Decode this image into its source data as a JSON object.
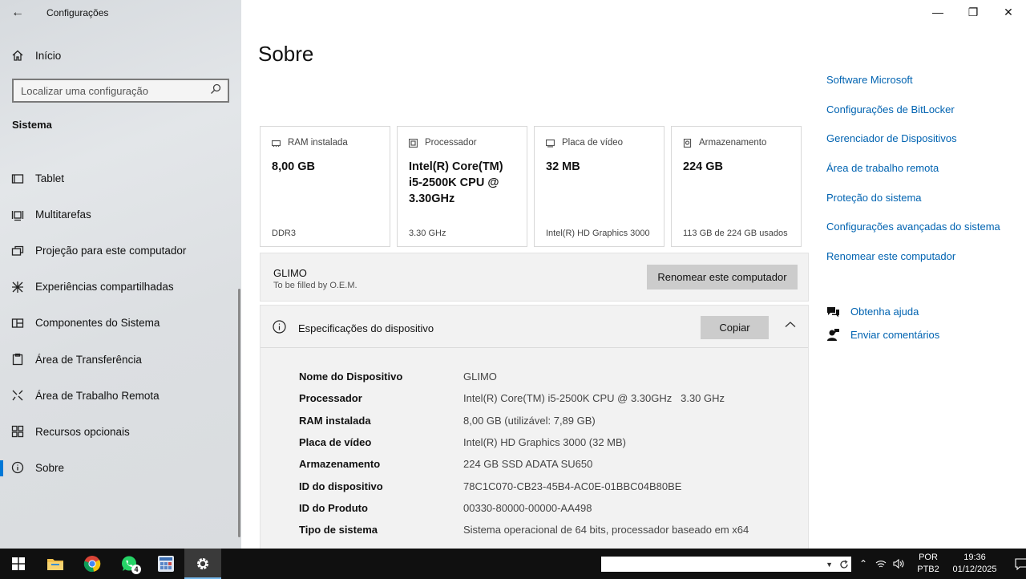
{
  "window": {
    "title": "Configurações"
  },
  "sidebar": {
    "home_label": "Início",
    "search_placeholder": "Localizar uma configuração",
    "section": "Sistema",
    "items": [
      {
        "label": "Tablet",
        "icon": "tablet-icon"
      },
      {
        "label": "Multitarefas",
        "icon": "multitasking-icon"
      },
      {
        "label": "Projeção para este computador",
        "icon": "projection-icon"
      },
      {
        "label": "Experiências compartilhadas",
        "icon": "shared-experiences-icon"
      },
      {
        "label": "Componentes do Sistema",
        "icon": "system-components-icon"
      },
      {
        "label": "Área de Transferência",
        "icon": "clipboard-icon"
      },
      {
        "label": "Área de Trabalho Remota",
        "icon": "remote-desktop-icon"
      },
      {
        "label": "Recursos opcionais",
        "icon": "optional-features-icon"
      },
      {
        "label": "Sobre",
        "icon": "info-icon",
        "active": true
      }
    ]
  },
  "main": {
    "title": "Sobre",
    "cards": [
      {
        "header": "RAM instalada",
        "value": "8,00 GB",
        "footer": "DDR3"
      },
      {
        "header": "Processador",
        "value": "Intel(R) Core(TM) i5-2500K CPU @ 3.30GHz",
        "footer": "3.30 GHz"
      },
      {
        "header": "Placa de vídeo",
        "value": "32 MB",
        "footer": "Intel(R) HD Graphics 3000"
      },
      {
        "header": "Armazenamento",
        "value": "224 GB",
        "footer": "113 GB de 224 GB usados"
      }
    ],
    "device_name": "GLIMO",
    "device_sub": "To be filled by O.E.M.",
    "rename_button": "Renomear este computador",
    "specs_title": "Especificações do dispositivo",
    "copy_button": "Copiar",
    "specs": [
      {
        "key": "Nome do Dispositivo",
        "value": "GLIMO"
      },
      {
        "key": "Processador",
        "value": "Intel(R) Core(TM) i5-2500K CPU @ 3.30GHz   3.30 GHz"
      },
      {
        "key": "RAM instalada",
        "value": "8,00 GB (utilizável: 7,89 GB)"
      },
      {
        "key": "Placa de vídeo",
        "value": "Intel(R) HD Graphics 3000 (32 MB)"
      },
      {
        "key": "Armazenamento",
        "value": "224 GB SSD ADATA SU650"
      },
      {
        "key": "ID do dispositivo",
        "value": "78C1C070-CB23-45B4-AC0E-01BBC04B80BE"
      },
      {
        "key": "ID do Produto",
        "value": "00330-80000-00000-AA498"
      },
      {
        "key": "Tipo de sistema",
        "value": "Sistema operacional de 64 bits, processador baseado em x64"
      }
    ]
  },
  "related_links": [
    "Software Microsoft",
    "Configurações de BitLocker",
    "Gerenciador de Dispositivos",
    "Área de trabalho remota",
    "Proteção do sistema",
    "Configurações avançadas do sistema",
    "Renomear este computador"
  ],
  "help": {
    "get_help": "Obtenha ajuda",
    "feedback": "Enviar comentários"
  },
  "taskbar": {
    "whatsapp_badge": "4",
    "language": "POR",
    "keyboard": "PTB2",
    "time": "19:36",
    "date": "01/12/2025"
  }
}
